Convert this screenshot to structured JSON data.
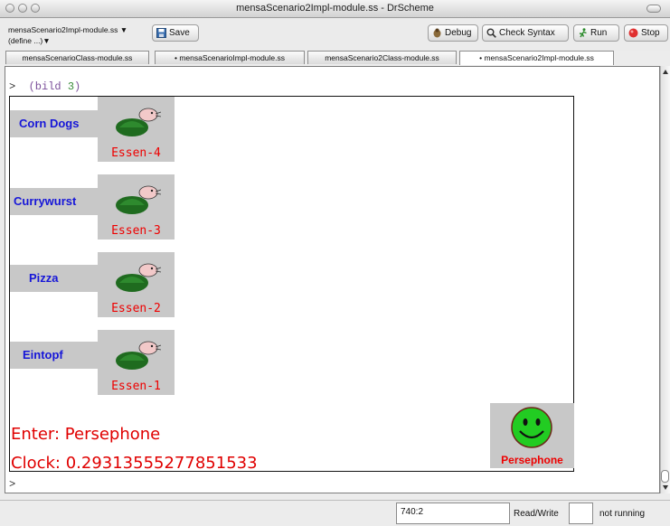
{
  "window": {
    "title": "mensaScenario2Impl-module.ss - DrScheme"
  },
  "toolbar": {
    "file_name": "mensaScenario2Impl-module.ss ▼",
    "define_menu": "(define ...)▼",
    "save_label": "Save",
    "debug_label": "Debug",
    "check_syntax_label": "Check Syntax",
    "run_label": "Run",
    "stop_label": "Stop"
  },
  "tabs": [
    {
      "label": "mensaScenarioClass-module.ss",
      "active": false
    },
    {
      "label": "• mensaScenarioImpl-module.ss",
      "active": false
    },
    {
      "label": "mensaScenario2Class-module.ss",
      "active": false
    },
    {
      "label": "• mensaScenario2Impl-module.ss",
      "active": true
    }
  ],
  "repl": {
    "prompt1": ">",
    "expr_open": "(bild ",
    "expr_num": "3",
    "expr_close": ")",
    "prompt2": ">"
  },
  "scene": {
    "foods": [
      {
        "name": "Corn Dogs",
        "counter": "Essen-4"
      },
      {
        "name": "Currywurst",
        "counter": "Essen-3"
      },
      {
        "name": "Pizza",
        "counter": "Essen-2"
      },
      {
        "name": "Eintopf",
        "counter": "Essen-1"
      }
    ],
    "enter_text": "Enter: Persephone",
    "clock_text": "Clock: 0.29313555277851533",
    "persephone_label": "Persephone"
  },
  "status": {
    "position": "740:2",
    "mode": "Read/Write",
    "running": "not running"
  },
  "colors": {
    "food_text": "#1616d8",
    "counter_text": "#e00000",
    "smiley": "#22cc22",
    "tile_bg": "#c8c8c8"
  }
}
